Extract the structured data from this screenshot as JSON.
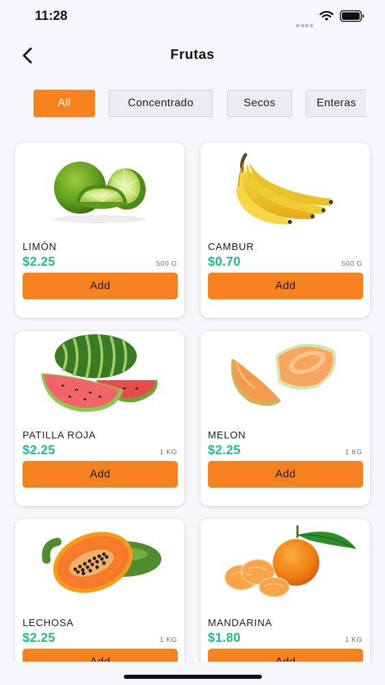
{
  "status_bar": {
    "time": "11:28"
  },
  "header": {
    "title": "Frutas"
  },
  "tabs": [
    {
      "label": "All",
      "active": true
    },
    {
      "label": "Concentrado",
      "active": false
    },
    {
      "label": "Secos",
      "active": false
    },
    {
      "label": "Enteras",
      "active": false
    }
  ],
  "products": [
    {
      "name": "LIMÓN",
      "price": "$2.25",
      "unit": "500 G",
      "button": "Add",
      "image": "lime"
    },
    {
      "name": "CAMBUR",
      "price": "$0.70",
      "unit": "500 G",
      "button": "Add",
      "image": "banana"
    },
    {
      "name": "PATILLA ROJA",
      "price": "$2.25",
      "unit": "1 KG",
      "button": "Add",
      "image": "watermelon"
    },
    {
      "name": "MELON",
      "price": "$2.25",
      "unit": "1 KG",
      "button": "Add",
      "image": "cantaloupe"
    },
    {
      "name": "LECHOSA",
      "price": "$2.25",
      "unit": "1 KG",
      "button": "Add",
      "image": "papaya"
    },
    {
      "name": "MANDARINA",
      "price": "$1.80",
      "unit": "1 KG",
      "button": "Add",
      "image": "tangerine"
    }
  ],
  "colors": {
    "accent": "#f5821f",
    "price": "#1fbc89",
    "background": "#f6f6f8"
  }
}
